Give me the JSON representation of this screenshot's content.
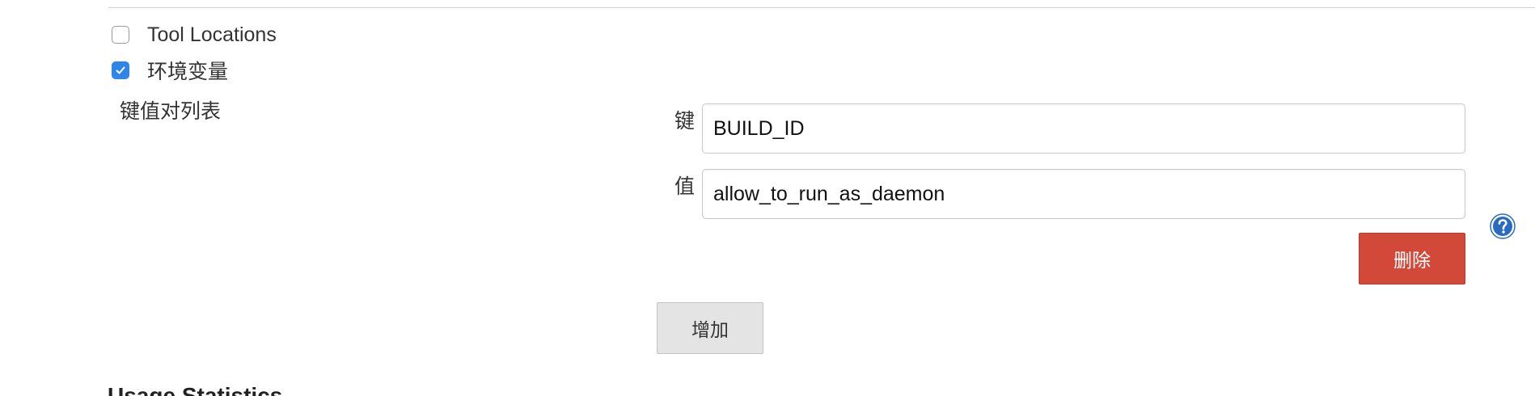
{
  "options": [
    {
      "label": "Tool Locations",
      "checked": false
    },
    {
      "label": "环境变量",
      "checked": true
    }
  ],
  "env_vars": {
    "section_label": "键值对列表",
    "key_label": "键",
    "key_value": "BUILD_ID",
    "value_label": "值",
    "value_value": "allow_to_run_as_daemon",
    "delete_label": "删除",
    "add_label": "增加"
  },
  "next_section": {
    "heading": "Usage Statistics"
  },
  "colors": {
    "delete_button": "#d24939",
    "checkbox_checked": "#2f86e8",
    "help_icon": "#2a6bc2"
  },
  "icons": {
    "help": "question-mark-circle-icon",
    "check": "checkmark-icon"
  }
}
